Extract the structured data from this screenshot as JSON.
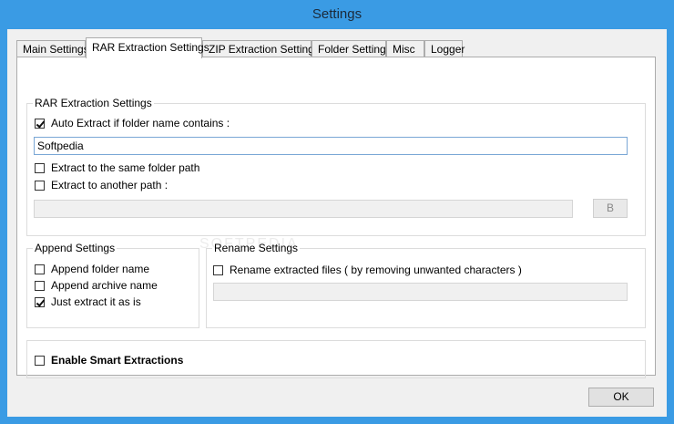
{
  "window": {
    "title": "Settings"
  },
  "tabs": [
    {
      "label": "Main Settings"
    },
    {
      "label": "RAR Extraction Settings",
      "active": true
    },
    {
      "label": "ZIP Extraction Settings"
    },
    {
      "label": "Folder Settings"
    },
    {
      "label": "Misc"
    },
    {
      "label": "Logger"
    }
  ],
  "rar_group": {
    "legend": "RAR Extraction Settings",
    "auto_extract_label": "Auto Extract if folder name contains :",
    "auto_extract_checked": true,
    "folder_name_value": "Softpedia",
    "same_folder_label": "Extract to the same folder path",
    "another_path_label": "Extract to another path :",
    "another_path_value": "",
    "browse_label": "B"
  },
  "append_group": {
    "legend": "Append Settings",
    "items": [
      {
        "label": "Append folder name",
        "checked": false
      },
      {
        "label": "Append archive name",
        "checked": false
      },
      {
        "label": "Just extract it as is",
        "checked": true
      }
    ]
  },
  "rename_group": {
    "legend": "Rename Settings",
    "rename_label": "Rename extracted files ( by removing unwanted characters )",
    "rename_value": ""
  },
  "smart_group": {
    "label": "Enable Smart Extractions"
  },
  "footer": {
    "ok_label": "OK"
  },
  "watermark": "SOFTPEDIA",
  "colors": {
    "titlebar": "#3a9be4",
    "focus_border": "#7aa7d6"
  }
}
